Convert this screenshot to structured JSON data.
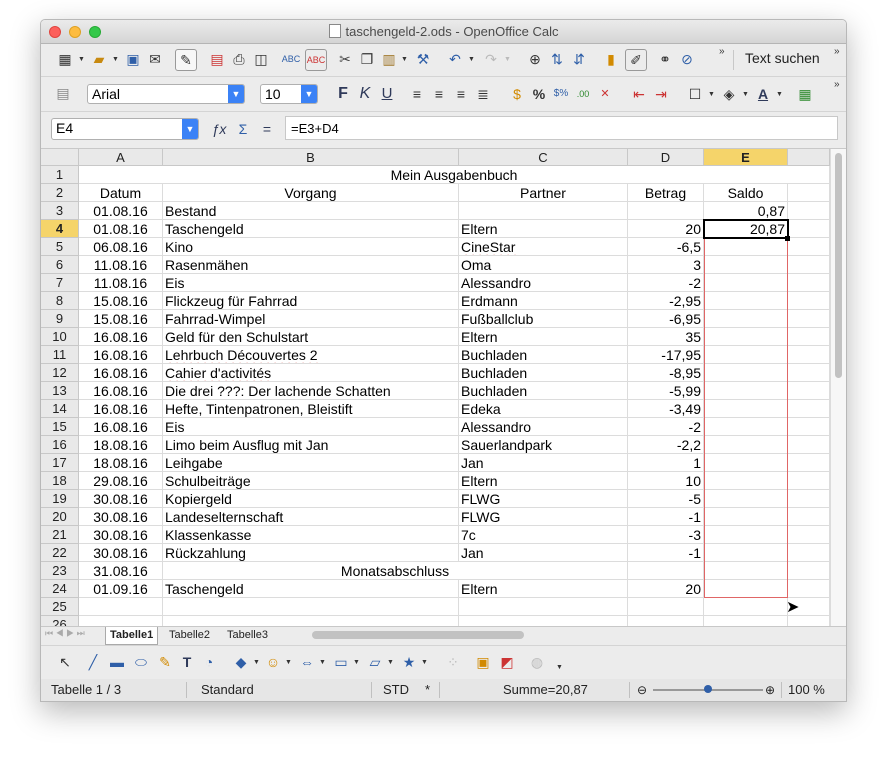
{
  "window": {
    "title": "taschengeld-2.ods - OpenOffice Calc"
  },
  "toolbar": {
    "search_label": "Text suchen",
    "font_name": "Arial",
    "font_size": "10",
    "bold": "F",
    "italic": "K",
    "underline": "U",
    "percent": "%",
    "function_wizard": "ƒx",
    "sum": "Σ",
    "equals": "="
  },
  "formula": {
    "name_box": "E4",
    "content": "=E3+D4"
  },
  "columns": [
    "A",
    "B",
    "C",
    "D",
    "E"
  ],
  "rows": [
    {
      "n": "1",
      "a": "",
      "b": "Mein Ausgabenbuch",
      "c": "",
      "d": "",
      "e": ""
    },
    {
      "n": "2",
      "a": "Datum",
      "b": "Vorgang",
      "c": "Partner",
      "d": "Betrag",
      "e": "Saldo"
    },
    {
      "n": "3",
      "a": "01.08.16",
      "b": "Bestand",
      "c": "",
      "d": "",
      "e": "0,87"
    },
    {
      "n": "4",
      "a": "01.08.16",
      "b": "Taschengeld",
      "c": "Eltern",
      "d": "20",
      "e": "20,87"
    },
    {
      "n": "5",
      "a": "06.08.16",
      "b": "Kino",
      "c": "CineStar",
      "d": "-6,5",
      "e": ""
    },
    {
      "n": "6",
      "a": "11.08.16",
      "b": "Rasenmähen",
      "c": "Oma",
      "d": "3",
      "e": ""
    },
    {
      "n": "7",
      "a": "11.08.16",
      "b": "Eis",
      "c": "Alessandro",
      "d": "-2",
      "e": ""
    },
    {
      "n": "8",
      "a": "15.08.16",
      "b": "Flickzeug für Fahrrad",
      "c": "Erdmann",
      "d": "-2,95",
      "e": ""
    },
    {
      "n": "9",
      "a": "15.08.16",
      "b": "Fahrrad-Wimpel",
      "c": "Fußballclub",
      "d": "-6,95",
      "e": ""
    },
    {
      "n": "10",
      "a": "16.08.16",
      "b": "Geld für den Schulstart",
      "c": "Eltern",
      "d": "35",
      "e": ""
    },
    {
      "n": "11",
      "a": "16.08.16",
      "b": "Lehrbuch Découvertes 2",
      "c": "Buchladen",
      "d": "-17,95",
      "e": ""
    },
    {
      "n": "12",
      "a": "16.08.16",
      "b": "Cahier d'activités",
      "c": "Buchladen",
      "d": "-8,95",
      "e": ""
    },
    {
      "n": "13",
      "a": "16.08.16",
      "b": "Die drei ???: Der lachende Schatten",
      "c": "Buchladen",
      "d": "-5,99",
      "e": ""
    },
    {
      "n": "14",
      "a": "16.08.16",
      "b": "Hefte, Tintenpatronen, Bleistift",
      "c": "Edeka",
      "d": "-3,49",
      "e": ""
    },
    {
      "n": "15",
      "a": "16.08.16",
      "b": "Eis",
      "c": "Alessandro",
      "d": "-2",
      "e": ""
    },
    {
      "n": "16",
      "a": "18.08.16",
      "b": "Limo beim Ausflug mit Jan",
      "c": "Sauerlandpark",
      "d": "-2,2",
      "e": ""
    },
    {
      "n": "17",
      "a": "18.08.16",
      "b": "Leihgabe",
      "c": "Jan",
      "d": "1",
      "e": ""
    },
    {
      "n": "18",
      "a": "29.08.16",
      "b": "Schulbeiträge",
      "c": "Eltern",
      "d": "10",
      "e": ""
    },
    {
      "n": "19",
      "a": "30.08.16",
      "b": "Kopiergeld",
      "c": "FLWG",
      "d": "-5",
      "e": ""
    },
    {
      "n": "20",
      "a": "30.08.16",
      "b": "Landeselternschaft",
      "c": "FLWG",
      "d": "-1",
      "e": ""
    },
    {
      "n": "21",
      "a": "30.08.16",
      "b": "Klassenkasse",
      "c": "7c",
      "d": "-3",
      "e": ""
    },
    {
      "n": "22",
      "a": "30.08.16",
      "b": "Rückzahlung",
      "c": "Jan",
      "d": "-1",
      "e": ""
    },
    {
      "n": "23",
      "a": "31.08.16",
      "b": "Monatsabschluss",
      "c": "",
      "d": "",
      "e": ""
    },
    {
      "n": "24",
      "a": "01.09.16",
      "b": "Taschengeld",
      "c": "Eltern",
      "d": "20",
      "e": ""
    },
    {
      "n": "25",
      "a": "",
      "b": "",
      "c": "",
      "d": "",
      "e": ""
    },
    {
      "n": "26",
      "a": "",
      "b": "",
      "c": "",
      "d": "",
      "e": ""
    }
  ],
  "sheet_tabs": [
    "Tabelle1",
    "Tabelle2",
    "Tabelle3"
  ],
  "status": {
    "sheet": "Tabelle 1 / 3",
    "style": "Standard",
    "mode": "STD",
    "modified": "*",
    "sum": "Summe=20,87",
    "zoom": "100 %",
    "zoom_level": 0.5
  },
  "colors": {
    "selection_header": "#f5d46a",
    "copy_range": "#e06666",
    "accent": "#3b82f6"
  }
}
